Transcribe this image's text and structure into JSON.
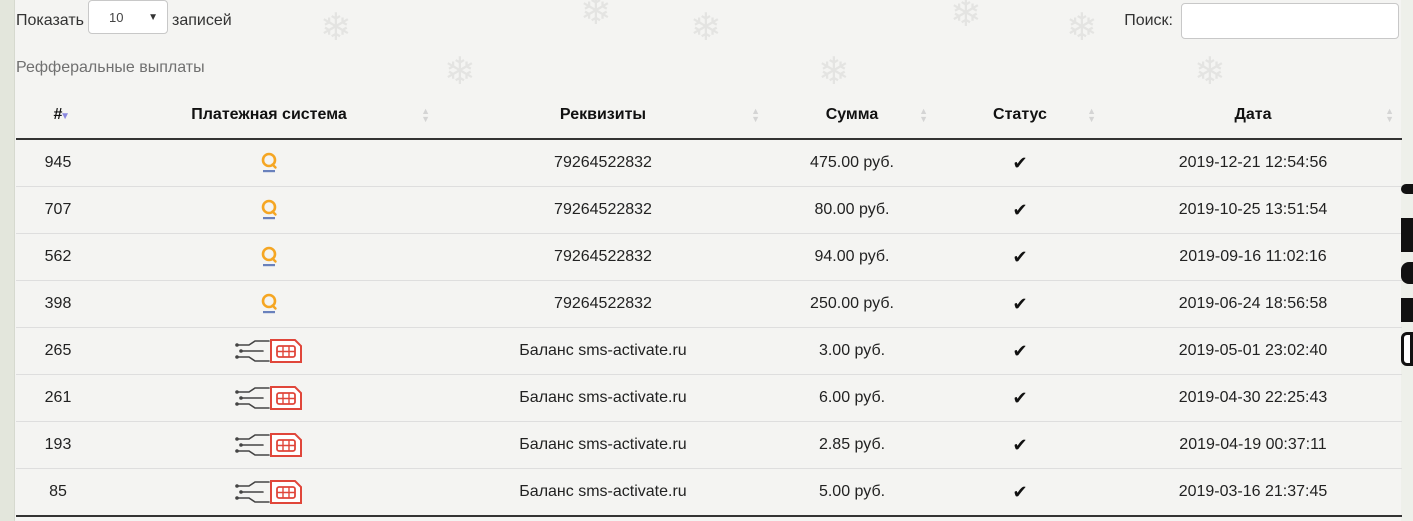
{
  "length_control": {
    "label_before": "Показать",
    "selected_value": "10",
    "label_after": "записей"
  },
  "search": {
    "label": "Поиск:",
    "value": "",
    "placeholder": ""
  },
  "caption": "Рефферальные выплаты",
  "table": {
    "columns": [
      {
        "label": "#",
        "sort": "asc"
      },
      {
        "label": "Платежная система",
        "sort": "none"
      },
      {
        "label": "Реквизиты",
        "sort": "none"
      },
      {
        "label": "Сумма",
        "sort": "none"
      },
      {
        "label": "Статус",
        "sort": "none"
      },
      {
        "label": "Дата",
        "sort": "none"
      }
    ],
    "rows": [
      {
        "id": "945",
        "system": "qiwi",
        "details": "79264522832",
        "amount": "475.00 руб.",
        "status": "check",
        "date": "2019-12-21 12:54:56"
      },
      {
        "id": "707",
        "system": "qiwi",
        "details": "79264522832",
        "amount": "80.00 руб.",
        "status": "check",
        "date": "2019-10-25 13:51:54"
      },
      {
        "id": "562",
        "system": "qiwi",
        "details": "79264522832",
        "amount": "94.00 руб.",
        "status": "check",
        "date": "2019-09-16 11:02:16"
      },
      {
        "id": "398",
        "system": "qiwi",
        "details": "79264522832",
        "amount": "250.00 руб.",
        "status": "check",
        "date": "2019-06-24 18:56:58"
      },
      {
        "id": "265",
        "system": "sms-activate",
        "details": "Баланс sms-activate.ru",
        "amount": "3.00 руб.",
        "status": "check",
        "date": "2019-05-01 23:02:40"
      },
      {
        "id": "261",
        "system": "sms-activate",
        "details": "Баланс sms-activate.ru",
        "amount": "6.00 руб.",
        "status": "check",
        "date": "2019-04-30 22:25:43"
      },
      {
        "id": "193",
        "system": "sms-activate",
        "details": "Баланс sms-activate.ru",
        "amount": "2.85 руб.",
        "status": "check",
        "date": "2019-04-19 00:37:11"
      },
      {
        "id": "85",
        "system": "sms-activate",
        "details": "Баланс sms-activate.ru",
        "amount": "5.00 руб.",
        "status": "check",
        "date": "2019-03-16 21:37:45"
      }
    ]
  },
  "icons": {
    "qiwi": "qiwi-logo-icon",
    "sms-activate": "sms-activate-logo-icon",
    "check": "checkmark-icon",
    "sort_asc": "sort-asc-icon",
    "sort_none": "sort-both-icon",
    "select_caret": "chevron-down-icon"
  },
  "colors": {
    "qiwi_orange": "#f5a623",
    "qiwi_text": "#3b5ba9",
    "sms_red": "#e0463a",
    "sort_active": "#8a88df"
  }
}
